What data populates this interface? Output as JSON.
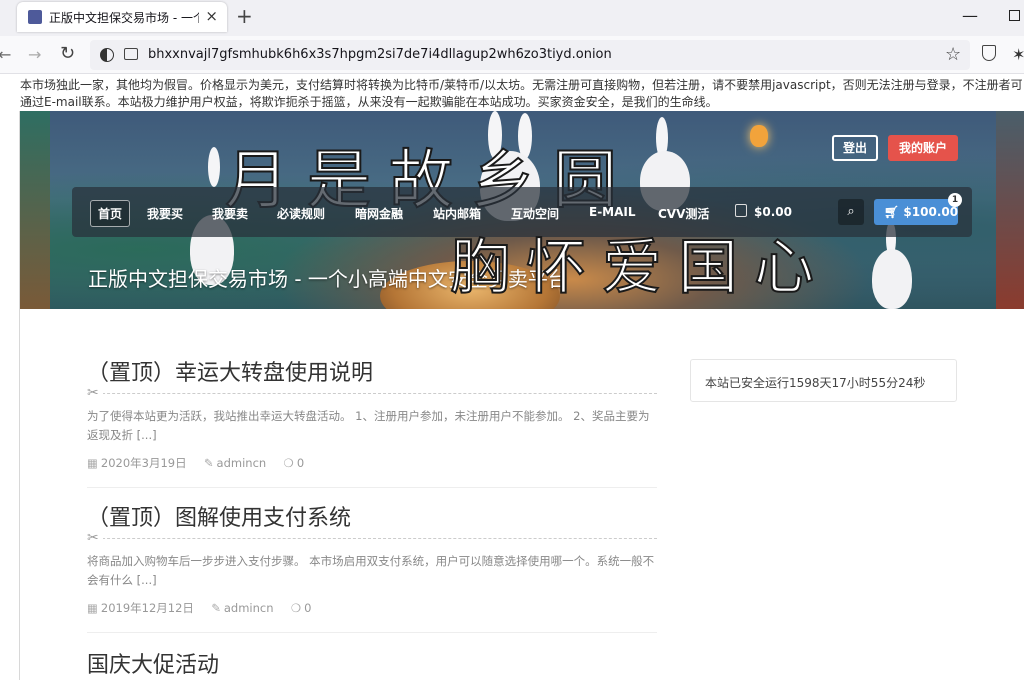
{
  "browser": {
    "tab_title": "正版中文担保交易市场 - 一个小",
    "tab_close": "×",
    "new_tab": "+",
    "minimize": "—",
    "url": "bhxxnvajl7gfsmhubk6h6x3s7hpgm2si7de7i4dllagup2wh6zo3tiyd.onion",
    "back_icon": "←",
    "forward_icon": "→",
    "reload_icon": "↻",
    "star_icon": "☆",
    "extension_icon": "✶"
  },
  "notice": "本市场独此一家，其他均为假冒。价格显示为美元，支付结算时将转换为比特币/莱特币/以太坊。无需注册可直接购物，但若注册，请不要禁用javascript，否则无法注册与登录，不注册者可通过E-mail联系。本站极力维护用户权益，将欺诈扼杀于摇篮，从来没有一起欺骗能在本站成功。买家资金安全，是我们的生命线。",
  "banner": {
    "calligraphy_line1": "月是故乡圆",
    "calligraphy_line2": "胸怀爱国心",
    "logout_label": "登出",
    "account_label": "我的账户",
    "site_title": "正版中文担保交易市场 - 一个小高端中文安全买卖平台"
  },
  "menu": {
    "items": [
      {
        "label": "首页"
      },
      {
        "label": "我要买"
      },
      {
        "label": "我要卖"
      },
      {
        "label": "必读规则"
      },
      {
        "label": "暗网金融"
      },
      {
        "label": "站内邮箱"
      },
      {
        "label": "互动空间"
      },
      {
        "label": "E-MAIL"
      },
      {
        "label": "CVV测活"
      }
    ],
    "cart_amount": "$0.00",
    "search_icon": "⌕",
    "cart_button_label": "$100.00",
    "cart_badge": "1"
  },
  "posts": [
    {
      "title": "（置顶）幸运大转盘使用说明",
      "excerpt": "为了使得本站更为活跃，我站推出幸运大转盘活动。 1、注册用户参加，未注册用户不能参加。 2、奖品主要为返现及折 [...]",
      "date": "2020年3月19日",
      "author": "admincn",
      "comments": "0"
    },
    {
      "title": "（置顶）图解使用支付系统",
      "excerpt": "将商品加入购物车后一步步进入支付步骤。 本市场启用双支付系统，用户可以随意选择使用哪一个。系统一般不会有什么 [...]",
      "date": "2019年12月12日",
      "author": "admincn",
      "comments": "0"
    },
    {
      "title": "国庆大促活动"
    }
  ],
  "sidebar": {
    "uptime": "本站已安全运行1598天17小时55分24秒"
  },
  "icons": {
    "scissors": "✂",
    "calendar": "▦",
    "pencil": "✎",
    "comment": "❍"
  }
}
